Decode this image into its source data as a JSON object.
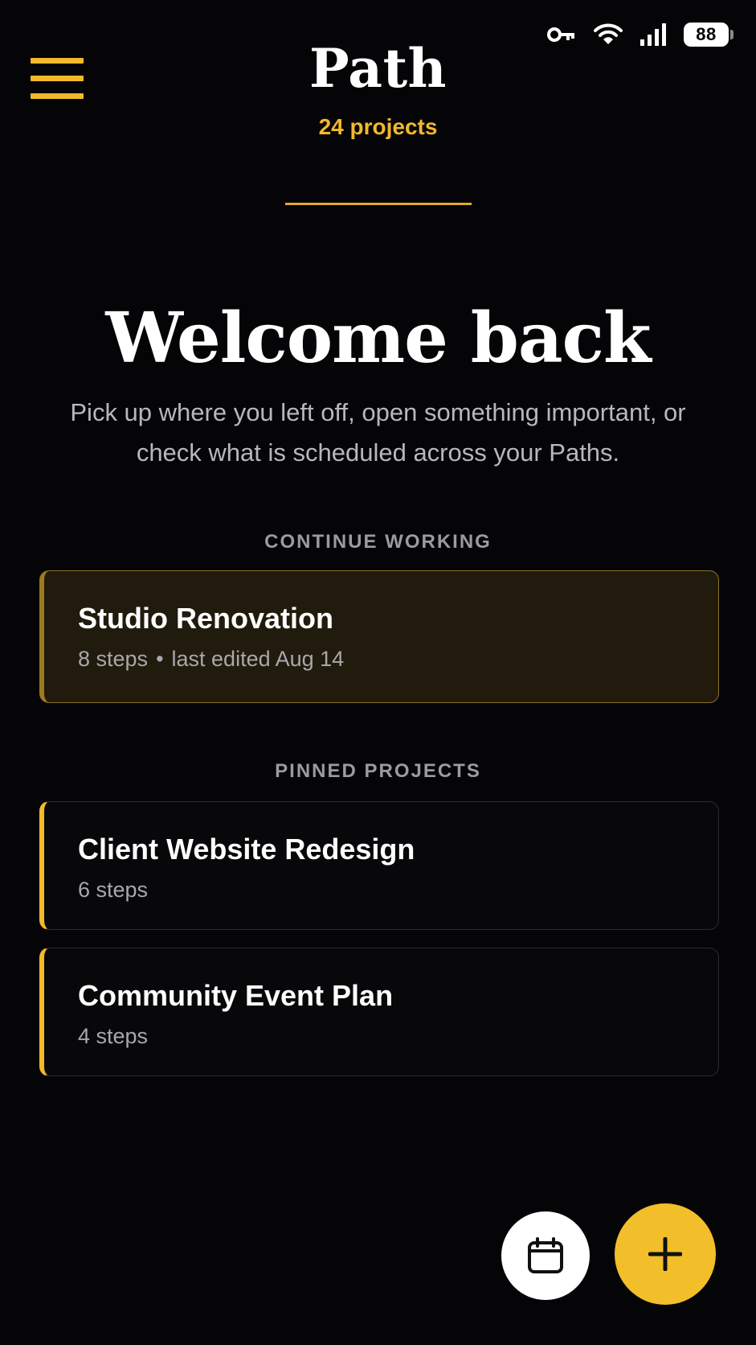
{
  "status_bar": {
    "battery_level": "88",
    "icons": [
      "key-icon",
      "wifi-icon",
      "signal-icon",
      "battery-icon"
    ]
  },
  "header": {
    "menu_icon": "hamburger-menu-icon",
    "title": "Path",
    "project_count": "24 projects"
  },
  "welcome": {
    "heading": "Welcome back",
    "subtitle": "Pick up where you left off, open something important, or check what is scheduled across your Paths."
  },
  "continue_working": {
    "section_label": "CONTINUE WORKING",
    "card": {
      "title": "Studio Renovation",
      "steps": "8 steps",
      "separator": "•",
      "edited": "last edited Aug 14"
    }
  },
  "pinned_projects": {
    "section_label": "PINNED PROJECTS",
    "items": [
      {
        "title": "Client Website Redesign",
        "steps": "6 steps"
      },
      {
        "title": "Community Event Plan",
        "steps": "4 steps"
      }
    ]
  },
  "fabs": {
    "calendar_icon": "calendar-icon",
    "add_icon": "plus-icon"
  },
  "colors": {
    "accent": "#f2b92a",
    "background": "#050507",
    "active_card": "#211b0d"
  }
}
